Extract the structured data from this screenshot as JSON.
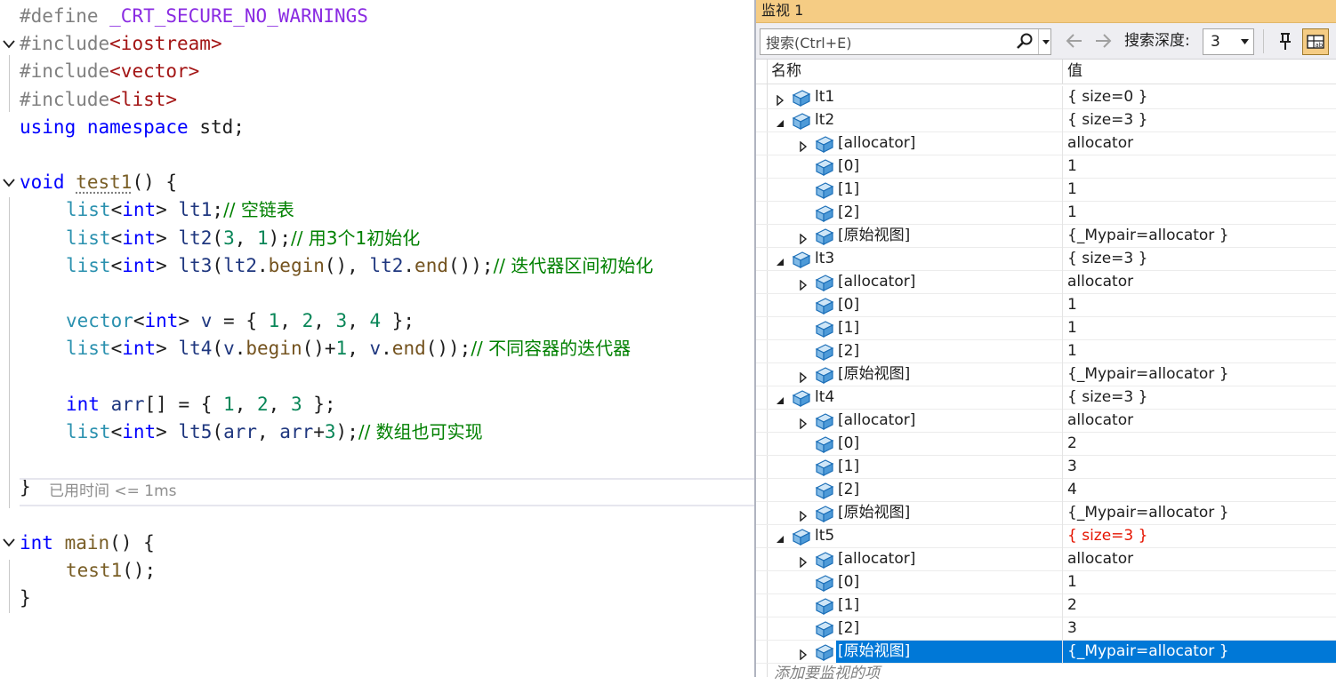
{
  "editor": {
    "lines": [
      {
        "fold": "none",
        "indent": 0,
        "tokens": [
          {
            "t": "#define ",
            "c": "tk-pre"
          },
          {
            "t": "_CRT_SECURE_NO_WARNINGS",
            "c": "tk-macro"
          }
        ]
      },
      {
        "fold": "open",
        "indent": 0,
        "tokens": [
          {
            "t": "#include",
            "c": "tk-pre"
          },
          {
            "t": "<iostream>",
            "c": "tk-inc"
          }
        ]
      },
      {
        "fold": "none",
        "indent": 0,
        "tokens": [
          {
            "t": "#include",
            "c": "tk-pre"
          },
          {
            "t": "<vector>",
            "c": "tk-inc"
          }
        ]
      },
      {
        "fold": "none",
        "indent": 0,
        "tokens": [
          {
            "t": "#include",
            "c": "tk-pre"
          },
          {
            "t": "<list>",
            "c": "tk-inc"
          }
        ]
      },
      {
        "fold": "none",
        "indent": 0,
        "tokens": [
          {
            "t": "using",
            "c": "tk-kw"
          },
          {
            "t": " ",
            "c": "tk-punc"
          },
          {
            "t": "namespace",
            "c": "tk-kw"
          },
          {
            "t": " std;",
            "c": "tk-punc"
          }
        ]
      },
      {
        "fold": "none",
        "indent": 0,
        "tokens": []
      },
      {
        "fold": "open",
        "indent": 0,
        "tokens": [
          {
            "t": "void",
            "c": "tk-kw"
          },
          {
            "t": " ",
            "c": "tk-punc"
          },
          {
            "t": "test1",
            "c": "tk-fn-u"
          },
          {
            "t": "() {",
            "c": "tk-punc"
          }
        ]
      },
      {
        "fold": "none",
        "indent": 1,
        "tokens": [
          {
            "t": "list",
            "c": "tk-type"
          },
          {
            "t": "<",
            "c": "tk-punc"
          },
          {
            "t": "int",
            "c": "tk-kw"
          },
          {
            "t": "> ",
            "c": "tk-punc"
          },
          {
            "t": "lt1",
            "c": "tk-var"
          },
          {
            "t": ";",
            "c": "tk-punc"
          },
          {
            "t": "// 空链表",
            "c": "tk-cmt"
          }
        ]
      },
      {
        "fold": "none",
        "indent": 1,
        "tokens": [
          {
            "t": "list",
            "c": "tk-type"
          },
          {
            "t": "<",
            "c": "tk-punc"
          },
          {
            "t": "int",
            "c": "tk-kw"
          },
          {
            "t": "> ",
            "c": "tk-punc"
          },
          {
            "t": "lt2",
            "c": "tk-var"
          },
          {
            "t": "(",
            "c": "tk-punc"
          },
          {
            "t": "3",
            "c": "tk-num"
          },
          {
            "t": ", ",
            "c": "tk-punc"
          },
          {
            "t": "1",
            "c": "tk-num"
          },
          {
            "t": ");",
            "c": "tk-punc"
          },
          {
            "t": "// 用3个1初始化",
            "c": "tk-cmt"
          }
        ]
      },
      {
        "fold": "none",
        "indent": 1,
        "tokens": [
          {
            "t": "list",
            "c": "tk-type"
          },
          {
            "t": "<",
            "c": "tk-punc"
          },
          {
            "t": "int",
            "c": "tk-kw"
          },
          {
            "t": "> ",
            "c": "tk-punc"
          },
          {
            "t": "lt3",
            "c": "tk-var"
          },
          {
            "t": "(",
            "c": "tk-punc"
          },
          {
            "t": "lt2",
            "c": "tk-var"
          },
          {
            "t": ".",
            "c": "tk-punc"
          },
          {
            "t": "begin",
            "c": "tk-mem"
          },
          {
            "t": "(), ",
            "c": "tk-punc"
          },
          {
            "t": "lt2",
            "c": "tk-var"
          },
          {
            "t": ".",
            "c": "tk-punc"
          },
          {
            "t": "end",
            "c": "tk-mem"
          },
          {
            "t": "());",
            "c": "tk-punc"
          },
          {
            "t": "// 迭代器区间初始化",
            "c": "tk-cmt"
          }
        ]
      },
      {
        "fold": "none",
        "indent": 1,
        "tokens": []
      },
      {
        "fold": "none",
        "indent": 1,
        "tokens": [
          {
            "t": "vector",
            "c": "tk-type"
          },
          {
            "t": "<",
            "c": "tk-punc"
          },
          {
            "t": "int",
            "c": "tk-kw"
          },
          {
            "t": "> ",
            "c": "tk-punc"
          },
          {
            "t": "v",
            "c": "tk-var"
          },
          {
            "t": " = { ",
            "c": "tk-punc"
          },
          {
            "t": "1",
            "c": "tk-num"
          },
          {
            "t": ", ",
            "c": "tk-punc"
          },
          {
            "t": "2",
            "c": "tk-num"
          },
          {
            "t": ", ",
            "c": "tk-punc"
          },
          {
            "t": "3",
            "c": "tk-num"
          },
          {
            "t": ", ",
            "c": "tk-punc"
          },
          {
            "t": "4",
            "c": "tk-num"
          },
          {
            "t": " };",
            "c": "tk-punc"
          }
        ]
      },
      {
        "fold": "none",
        "indent": 1,
        "tokens": [
          {
            "t": "list",
            "c": "tk-type"
          },
          {
            "t": "<",
            "c": "tk-punc"
          },
          {
            "t": "int",
            "c": "tk-kw"
          },
          {
            "t": "> ",
            "c": "tk-punc"
          },
          {
            "t": "lt4",
            "c": "tk-var"
          },
          {
            "t": "(",
            "c": "tk-punc"
          },
          {
            "t": "v",
            "c": "tk-var"
          },
          {
            "t": ".",
            "c": "tk-punc"
          },
          {
            "t": "begin",
            "c": "tk-mem"
          },
          {
            "t": "()+",
            "c": "tk-punc"
          },
          {
            "t": "1",
            "c": "tk-num"
          },
          {
            "t": ", ",
            "c": "tk-punc"
          },
          {
            "t": "v",
            "c": "tk-var"
          },
          {
            "t": ".",
            "c": "tk-punc"
          },
          {
            "t": "end",
            "c": "tk-mem"
          },
          {
            "t": "());",
            "c": "tk-punc"
          },
          {
            "t": "// 不同容器的迭代器",
            "c": "tk-cmt"
          }
        ]
      },
      {
        "fold": "none",
        "indent": 1,
        "tokens": []
      },
      {
        "fold": "none",
        "indent": 1,
        "tokens": [
          {
            "t": "int",
            "c": "tk-kw"
          },
          {
            "t": " ",
            "c": "tk-punc"
          },
          {
            "t": "arr",
            "c": "tk-var"
          },
          {
            "t": "[] = { ",
            "c": "tk-punc"
          },
          {
            "t": "1",
            "c": "tk-num"
          },
          {
            "t": ", ",
            "c": "tk-punc"
          },
          {
            "t": "2",
            "c": "tk-num"
          },
          {
            "t": ", ",
            "c": "tk-punc"
          },
          {
            "t": "3",
            "c": "tk-num"
          },
          {
            "t": " };",
            "c": "tk-punc"
          }
        ]
      },
      {
        "fold": "none",
        "indent": 1,
        "tokens": [
          {
            "t": "list",
            "c": "tk-type"
          },
          {
            "t": "<",
            "c": "tk-punc"
          },
          {
            "t": "int",
            "c": "tk-kw"
          },
          {
            "t": "> ",
            "c": "tk-punc"
          },
          {
            "t": "lt5",
            "c": "tk-var"
          },
          {
            "t": "(",
            "c": "tk-punc"
          },
          {
            "t": "arr",
            "c": "tk-var"
          },
          {
            "t": ", ",
            "c": "tk-punc"
          },
          {
            "t": "arr",
            "c": "tk-var"
          },
          {
            "t": "+",
            "c": "tk-punc"
          },
          {
            "t": "3",
            "c": "tk-num"
          },
          {
            "t": ");",
            "c": "tk-punc"
          },
          {
            "t": "// 数组也可实现",
            "c": "tk-cmt"
          }
        ]
      },
      {
        "fold": "none",
        "indent": 1,
        "tokens": []
      },
      {
        "fold": "none",
        "indent": 0,
        "tokens": [
          {
            "t": "}",
            "c": "tk-punc"
          }
        ]
      },
      {
        "fold": "none",
        "indent": 0,
        "tokens": []
      },
      {
        "fold": "open",
        "indent": 0,
        "tokens": [
          {
            "t": "int",
            "c": "tk-kw"
          },
          {
            "t": " ",
            "c": "tk-punc"
          },
          {
            "t": "main",
            "c": "tk-fn"
          },
          {
            "t": "() {",
            "c": "tk-punc"
          }
        ]
      },
      {
        "fold": "none",
        "indent": 1,
        "tokens": [
          {
            "t": "test1",
            "c": "tk-fn"
          },
          {
            "t": "();",
            "c": "tk-punc"
          }
        ]
      },
      {
        "fold": "none",
        "indent": 0,
        "tokens": [
          {
            "t": "}",
            "c": "tk-punc"
          }
        ]
      }
    ],
    "elapsed_hint": "已用时间 <= 1ms"
  },
  "watch": {
    "title": "监视 1",
    "search_placeholder": "搜索(Ctrl+E)",
    "depth_label": "搜索深度:",
    "depth_value": "3",
    "col_name": "名称",
    "col_value": "值",
    "add_item": "添加要监视的项",
    "rows": [
      {
        "level": 0,
        "expander": "collapsed",
        "name": "lt1",
        "value": "{ size=0 }",
        "changed": false,
        "selected": false
      },
      {
        "level": 0,
        "expander": "expanded",
        "name": "lt2",
        "value": "{ size=3 }",
        "changed": false,
        "selected": false
      },
      {
        "level": 1,
        "expander": "collapsed",
        "name": "[allocator]",
        "value": "allocator",
        "changed": false,
        "selected": false
      },
      {
        "level": 1,
        "expander": "none",
        "name": "[0]",
        "value": "1",
        "changed": false,
        "selected": false
      },
      {
        "level": 1,
        "expander": "none",
        "name": "[1]",
        "value": "1",
        "changed": false,
        "selected": false
      },
      {
        "level": 1,
        "expander": "none",
        "name": "[2]",
        "value": "1",
        "changed": false,
        "selected": false
      },
      {
        "level": 1,
        "expander": "collapsed",
        "name": "[原始视图]",
        "value": "{_Mypair=allocator }",
        "changed": false,
        "selected": false
      },
      {
        "level": 0,
        "expander": "expanded",
        "name": "lt3",
        "value": "{ size=3 }",
        "changed": false,
        "selected": false
      },
      {
        "level": 1,
        "expander": "collapsed",
        "name": "[allocator]",
        "value": "allocator",
        "changed": false,
        "selected": false
      },
      {
        "level": 1,
        "expander": "none",
        "name": "[0]",
        "value": "1",
        "changed": false,
        "selected": false
      },
      {
        "level": 1,
        "expander": "none",
        "name": "[1]",
        "value": "1",
        "changed": false,
        "selected": false
      },
      {
        "level": 1,
        "expander": "none",
        "name": "[2]",
        "value": "1",
        "changed": false,
        "selected": false
      },
      {
        "level": 1,
        "expander": "collapsed",
        "name": "[原始视图]",
        "value": "{_Mypair=allocator }",
        "changed": false,
        "selected": false
      },
      {
        "level": 0,
        "expander": "expanded",
        "name": "lt4",
        "value": "{ size=3 }",
        "changed": false,
        "selected": false
      },
      {
        "level": 1,
        "expander": "collapsed",
        "name": "[allocator]",
        "value": "allocator",
        "changed": false,
        "selected": false
      },
      {
        "level": 1,
        "expander": "none",
        "name": "[0]",
        "value": "2",
        "changed": false,
        "selected": false
      },
      {
        "level": 1,
        "expander": "none",
        "name": "[1]",
        "value": "3",
        "changed": false,
        "selected": false
      },
      {
        "level": 1,
        "expander": "none",
        "name": "[2]",
        "value": "4",
        "changed": false,
        "selected": false
      },
      {
        "level": 1,
        "expander": "collapsed",
        "name": "[原始视图]",
        "value": "{_Mypair=allocator }",
        "changed": false,
        "selected": false
      },
      {
        "level": 0,
        "expander": "expanded",
        "name": "lt5",
        "value": "{ size=3 }",
        "changed": true,
        "selected": false
      },
      {
        "level": 1,
        "expander": "collapsed",
        "name": "[allocator]",
        "value": "allocator",
        "changed": false,
        "selected": false
      },
      {
        "level": 1,
        "expander": "none",
        "name": "[0]",
        "value": "1",
        "changed": false,
        "selected": false
      },
      {
        "level": 1,
        "expander": "none",
        "name": "[1]",
        "value": "2",
        "changed": false,
        "selected": false
      },
      {
        "level": 1,
        "expander": "none",
        "name": "[2]",
        "value": "3",
        "changed": false,
        "selected": false
      },
      {
        "level": 1,
        "expander": "collapsed",
        "name": "[原始视图]",
        "value": "{_Mypair=allocator }",
        "changed": false,
        "selected": true
      }
    ]
  },
  "colors": {
    "watch_title_bg": "#f5cc84",
    "selection": "#0078d7",
    "changed_value": "#e51400"
  }
}
